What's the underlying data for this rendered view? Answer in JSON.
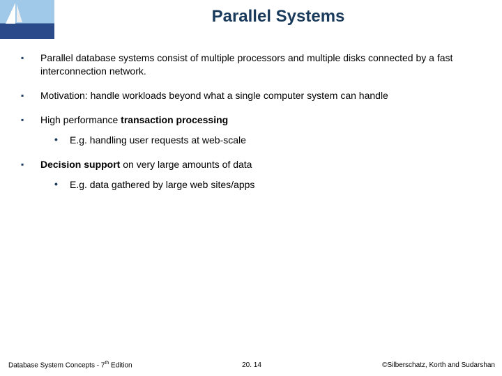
{
  "title": "Parallel Systems",
  "bullets": [
    {
      "text": "Parallel database systems consist of multiple processors and multiple disks connected by a fast interconnection network."
    },
    {
      "text": "Motivation: handle workloads beyond what a single computer system can handle"
    },
    {
      "prefix": "High performance ",
      "bold": "transaction processing",
      "sub": [
        "E.g. handling user requests at web-scale"
      ]
    },
    {
      "bold": "Decision support",
      "suffix": " on very large amounts of data",
      "sub": [
        "E.g. data gathered by large web sites/apps"
      ]
    }
  ],
  "footer": {
    "left_prefix": "Database System Concepts - 7",
    "left_sup": "th",
    "left_suffix": " Edition",
    "center": "20. 14",
    "right": "©Silberschatz, Korth and Sudarshan"
  }
}
